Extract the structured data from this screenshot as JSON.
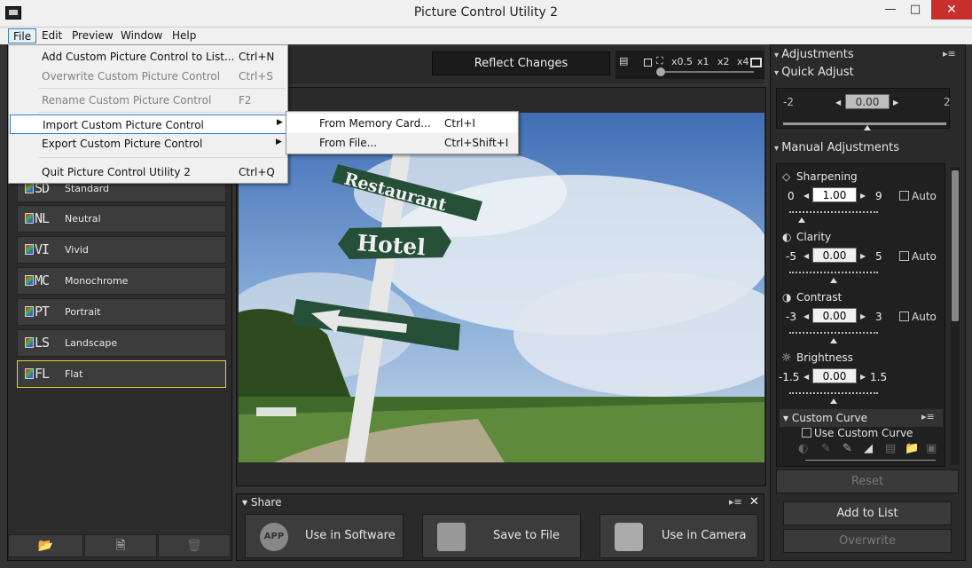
{
  "window": {
    "title": "Picture Control Utility 2"
  },
  "menubar": [
    "File",
    "Edit",
    "Preview",
    "Window",
    "Help"
  ],
  "file_menu": [
    {
      "label": "Add Custom Picture Control to List...",
      "shortcut": "Ctrl+N",
      "disabled": false
    },
    {
      "label": "Overwrite Custom Picture Control",
      "shortcut": "Ctrl+S",
      "disabled": true
    },
    {
      "label": "Rename Custom Picture Control",
      "shortcut": "F2",
      "disabled": true
    },
    {
      "label": "Import Custom Picture Control",
      "shortcut": "",
      "disabled": false,
      "submenu": true
    },
    {
      "label": "Export Custom Picture Control",
      "shortcut": "",
      "disabled": false,
      "submenu": true
    },
    {
      "label": "Quit Picture Control Utility 2",
      "shortcut": "Ctrl+Q",
      "disabled": false
    }
  ],
  "import_submenu": [
    {
      "label": "From Memory Card...",
      "shortcut": "Ctrl+I"
    },
    {
      "label": "From File...",
      "shortcut": "Ctrl+Shift+I"
    }
  ],
  "picture_controls": [
    {
      "code": "SD",
      "name": "Standard"
    },
    {
      "code": "NL",
      "name": "Neutral"
    },
    {
      "code": "VI",
      "name": "Vivid"
    },
    {
      "code": "MC",
      "name": "Monochrome"
    },
    {
      "code": "PT",
      "name": "Portrait"
    },
    {
      "code": "LS",
      "name": "Landscape"
    },
    {
      "code": "FL",
      "name": "Flat"
    }
  ],
  "toolbar": {
    "reflect_changes": "Reflect Changes",
    "zoom": [
      "x0.5",
      "x1",
      "x2",
      "x4"
    ]
  },
  "share": {
    "title": "Share",
    "buttons": [
      "Use in Software",
      "Save to File",
      "Use in Camera"
    ],
    "app_icon_text": "APP"
  },
  "right": {
    "adjustments": "Adjustments",
    "quick_adjust": "Quick Adjust",
    "quick": {
      "min": "-2",
      "max": "2",
      "value": "0.00"
    },
    "manual_adjustments": "Manual Adjustments",
    "auto_label": "Auto",
    "sharpening": {
      "label": "Sharpening",
      "min": "0",
      "max": "9",
      "value": "1.00"
    },
    "clarity": {
      "label": "Clarity",
      "min": "-5",
      "max": "5",
      "value": "0.00"
    },
    "contrast": {
      "label": "Contrast",
      "min": "-3",
      "max": "3",
      "value": "0.00"
    },
    "brightness": {
      "label": "Brightness",
      "min": "-1.5",
      "max": "1.5",
      "value": "0.00"
    },
    "custom_curve": "Custom Curve",
    "use_custom_curve": "Use Custom Curve",
    "reset": "Reset",
    "add_to_list": "Add to List",
    "overwrite": "Overwrite"
  },
  "preview_signs": [
    "Restaurant",
    "Hotel"
  ]
}
